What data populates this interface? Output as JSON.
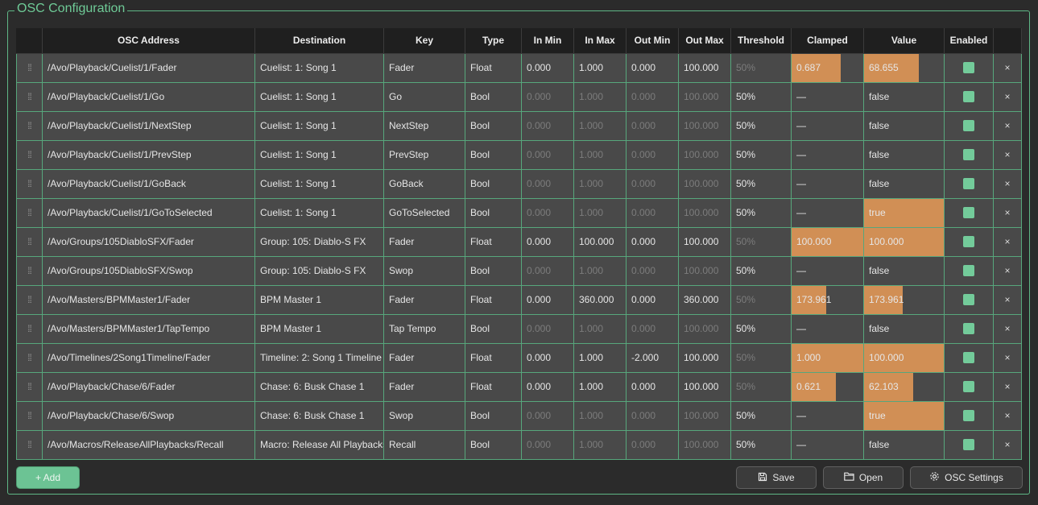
{
  "panel": {
    "title": "OSC Configuration"
  },
  "columns": [
    "",
    "OSC Address",
    "Destination",
    "Key",
    "Type",
    "In Min",
    "In Max",
    "Out Min",
    "Out Max",
    "Threshold",
    "Clamped",
    "Value",
    "Enabled",
    ""
  ],
  "rows": [
    {
      "address": "/Avo/Playback/Cuelist/1/Fader",
      "destination": "Cuelist: 1: Song 1",
      "key": "Fader",
      "type": "Float",
      "in_min": "0.000",
      "in_max": "1.000",
      "out_min": "0.000",
      "out_max": "100.000",
      "threshold": "50%",
      "clamped": "0.687",
      "clamped_level": 0.687,
      "value": "68.655",
      "value_level": 0.687,
      "enabled": true,
      "remove": "×"
    },
    {
      "address": "/Avo/Playback/Cuelist/1/Go",
      "destination": "Cuelist: 1: Song 1",
      "key": "Go",
      "type": "Bool",
      "in_min": "0.000",
      "in_max": "1.000",
      "out_min": "0.000",
      "out_max": "100.000",
      "threshold": "50%",
      "clamped": "—",
      "clamped_level": 0,
      "value": "false",
      "value_level": 0,
      "enabled": true,
      "remove": "×"
    },
    {
      "address": "/Avo/Playback/Cuelist/1/NextStep",
      "destination": "Cuelist: 1: Song 1",
      "key": "NextStep",
      "type": "Bool",
      "in_min": "0.000",
      "in_max": "1.000",
      "out_min": "0.000",
      "out_max": "100.000",
      "threshold": "50%",
      "clamped": "—",
      "clamped_level": 0,
      "value": "false",
      "value_level": 0,
      "enabled": true,
      "remove": "×"
    },
    {
      "address": "/Avo/Playback/Cuelist/1/PrevStep",
      "destination": "Cuelist: 1: Song 1",
      "key": "PrevStep",
      "type": "Bool",
      "in_min": "0.000",
      "in_max": "1.000",
      "out_min": "0.000",
      "out_max": "100.000",
      "threshold": "50%",
      "clamped": "—",
      "clamped_level": 0,
      "value": "false",
      "value_level": 0,
      "enabled": true,
      "remove": "×"
    },
    {
      "address": "/Avo/Playback/Cuelist/1/GoBack",
      "destination": "Cuelist: 1: Song 1",
      "key": "GoBack",
      "type": "Bool",
      "in_min": "0.000",
      "in_max": "1.000",
      "out_min": "0.000",
      "out_max": "100.000",
      "threshold": "50%",
      "clamped": "—",
      "clamped_level": 0,
      "value": "false",
      "value_level": 0,
      "enabled": true,
      "remove": "×"
    },
    {
      "address": "/Avo/Playback/Cuelist/1/GoToSelected",
      "destination": "Cuelist: 1: Song 1",
      "key": "GoToSelected",
      "type": "Bool",
      "in_min": "0.000",
      "in_max": "1.000",
      "out_min": "0.000",
      "out_max": "100.000",
      "threshold": "50%",
      "clamped": "—",
      "clamped_level": 0,
      "value": "true",
      "value_level": 1,
      "enabled": true,
      "remove": "×"
    },
    {
      "address": "/Avo/Groups/105DiabloSFX/Fader",
      "destination": "Group: 105: Diablo-S FX",
      "key": "Fader",
      "type": "Float",
      "in_min": "0.000",
      "in_max": "100.000",
      "out_min": "0.000",
      "out_max": "100.000",
      "threshold": "50%",
      "clamped": "100.000",
      "clamped_level": 1,
      "value": "100.000",
      "value_level": 1,
      "enabled": true,
      "remove": "×"
    },
    {
      "address": "/Avo/Groups/105DiabloSFX/Swop",
      "destination": "Group: 105: Diablo-S FX",
      "key": "Swop",
      "type": "Bool",
      "in_min": "0.000",
      "in_max": "1.000",
      "out_min": "0.000",
      "out_max": "100.000",
      "threshold": "50%",
      "clamped": "—",
      "clamped_level": 0,
      "value": "false",
      "value_level": 0,
      "enabled": true,
      "remove": "×"
    },
    {
      "address": "/Avo/Masters/BPMMaster1/Fader",
      "destination": "BPM Master 1",
      "key": "Fader",
      "type": "Float",
      "in_min": "0.000",
      "in_max": "360.000",
      "out_min": "0.000",
      "out_max": "360.000",
      "threshold": "50%",
      "clamped": "173.961",
      "clamped_level": 0.483,
      "value": "173.961",
      "value_level": 0.483,
      "enabled": true,
      "remove": "×"
    },
    {
      "address": "/Avo/Masters/BPMMaster1/TapTempo",
      "destination": "BPM Master 1",
      "key": "Tap Tempo",
      "type": "Bool",
      "in_min": "0.000",
      "in_max": "1.000",
      "out_min": "0.000",
      "out_max": "100.000",
      "threshold": "50%",
      "clamped": "—",
      "clamped_level": 0,
      "value": "false",
      "value_level": 0,
      "enabled": true,
      "remove": "×"
    },
    {
      "address": "/Avo/Timelines/2Song1Timeline/Fader",
      "destination": "Timeline: 2: Song 1 Timeline",
      "key": "Fader",
      "type": "Float",
      "in_min": "0.000",
      "in_max": "1.000",
      "out_min": "-2.000",
      "out_max": "100.000",
      "threshold": "50%",
      "clamped": "1.000",
      "clamped_level": 1,
      "value": "100.000",
      "value_level": 1,
      "enabled": true,
      "remove": "×"
    },
    {
      "address": "/Avo/Playback/Chase/6/Fader",
      "destination": "Chase: 6: Busk Chase 1",
      "key": "Fader",
      "type": "Float",
      "in_min": "0.000",
      "in_max": "1.000",
      "out_min": "0.000",
      "out_max": "100.000",
      "threshold": "50%",
      "clamped": "0.621",
      "clamped_level": 0.621,
      "value": "62.103",
      "value_level": 0.621,
      "enabled": true,
      "remove": "×"
    },
    {
      "address": "/Avo/Playback/Chase/6/Swop",
      "destination": "Chase: 6: Busk Chase 1",
      "key": "Swop",
      "type": "Bool",
      "in_min": "0.000",
      "in_max": "1.000",
      "out_min": "0.000",
      "out_max": "100.000",
      "threshold": "50%",
      "clamped": "—",
      "clamped_level": 0,
      "value": "true",
      "value_level": 1,
      "enabled": true,
      "remove": "×"
    },
    {
      "address": "/Avo/Macros/ReleaseAllPlaybacks/Recall",
      "destination": "Macro: Release All Playbacks",
      "key": "Recall",
      "type": "Bool",
      "in_min": "0.000",
      "in_max": "1.000",
      "out_min": "0.000",
      "out_max": "100.000",
      "threshold": "50%",
      "clamped": "—",
      "clamped_level": 0,
      "value": "false",
      "value_level": 0,
      "enabled": true,
      "remove": "×"
    }
  ],
  "buttons": {
    "add": "+ Add",
    "save": "Save",
    "open": "Open",
    "settings": "OSC Settings"
  },
  "icons": {
    "drag": "drag-handle-icon",
    "save": "floppy-disk-icon",
    "open": "folder-icon",
    "settings": "gear-icon",
    "remove": "close-icon"
  },
  "colors": {
    "accent": "#6cc394",
    "border": "#57a77c",
    "bar": "#d18f55",
    "row_bg": "#494949",
    "dim_text": "#7c7c7c"
  }
}
